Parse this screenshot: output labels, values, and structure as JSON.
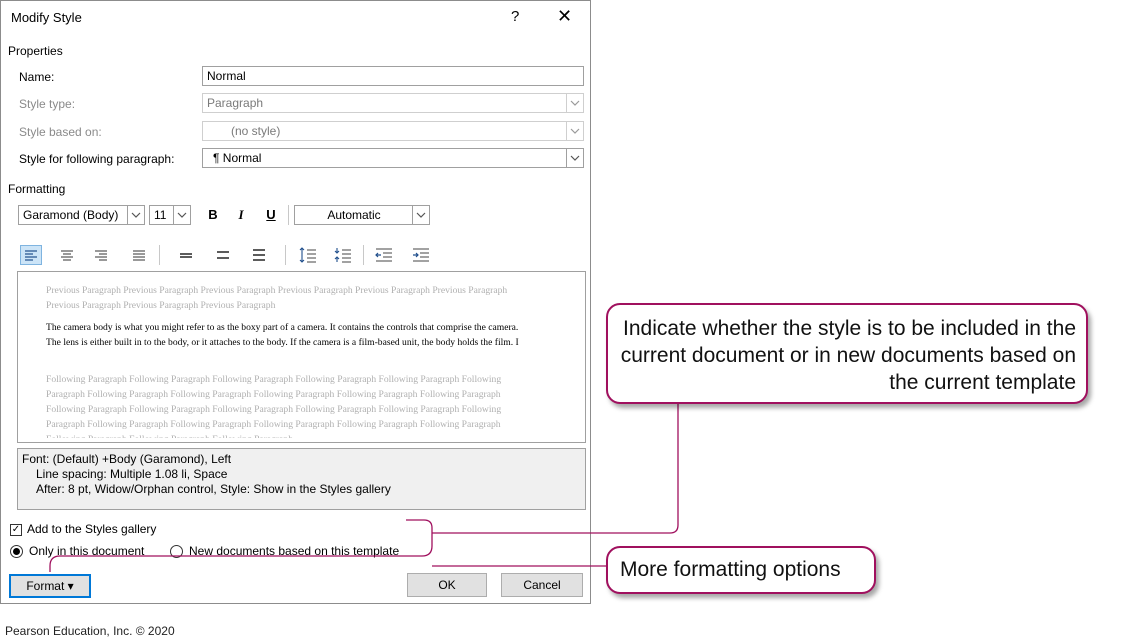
{
  "dialog": {
    "title": "Modify Style",
    "help": "?",
    "close": "✕"
  },
  "properties": {
    "heading": "Properties",
    "name_label": "Name:",
    "name_value": "Normal",
    "style_type_label": "Style type:",
    "style_type_value": "Paragraph",
    "based_on_label": "Style based on:",
    "based_on_value": "(no style)",
    "following_label": "Style for following paragraph:",
    "following_value": "¶  Normal"
  },
  "formatting": {
    "heading": "Formatting",
    "font": "Garamond (Body)",
    "size": "11",
    "bold": "B",
    "italic": "I",
    "underline": "U",
    "color": "Automatic"
  },
  "preview": {
    "previous": "Previous Paragraph Previous Paragraph Previous Paragraph Previous Paragraph Previous Paragraph Previous Paragraph Previous Paragraph Previous Paragraph Previous Paragraph",
    "sample": "The camera body is what you might refer to as the boxy part of a camera. It contains the controls that comprise the camera. The lens is either built in to the body, or it attaches to the body. If the camera is a film-based unit, the body holds the film. I",
    "following": "Following Paragraph Following Paragraph Following Paragraph Following Paragraph Following Paragraph Following Paragraph Following Paragraph Following Paragraph Following Paragraph Following Paragraph Following Paragraph Following Paragraph Following Paragraph Following Paragraph Following Paragraph Following Paragraph Following Paragraph Following Paragraph Following Paragraph Following Paragraph Following Paragraph Following Paragraph Following Paragraph Following Paragraph Following Paragraph"
  },
  "description": {
    "line1": "Font: (Default) +Body (Garamond), Left",
    "line2": "Line spacing:  Multiple 1.08 li, Space",
    "line3": "After:  8 pt, Widow/Orphan control, Style: Show in the Styles gallery"
  },
  "options": {
    "add_gallery": "Add to the Styles gallery",
    "add_gallery_checked": true,
    "only_doc": "Only in this document",
    "new_docs": "New documents based on this template",
    "selected": "only_doc"
  },
  "buttons": {
    "format": "Format ▾",
    "ok": "OK",
    "cancel": "Cancel"
  },
  "callouts": {
    "scope": "Indicate whether the style is to be included in the current document or in new documents based on the current template",
    "format": "More formatting options"
  },
  "footer": "Pearson Education, Inc. © 2020",
  "colors": {
    "callout_border": "#a0105e",
    "selected_align_bg": "#cce4f7"
  }
}
